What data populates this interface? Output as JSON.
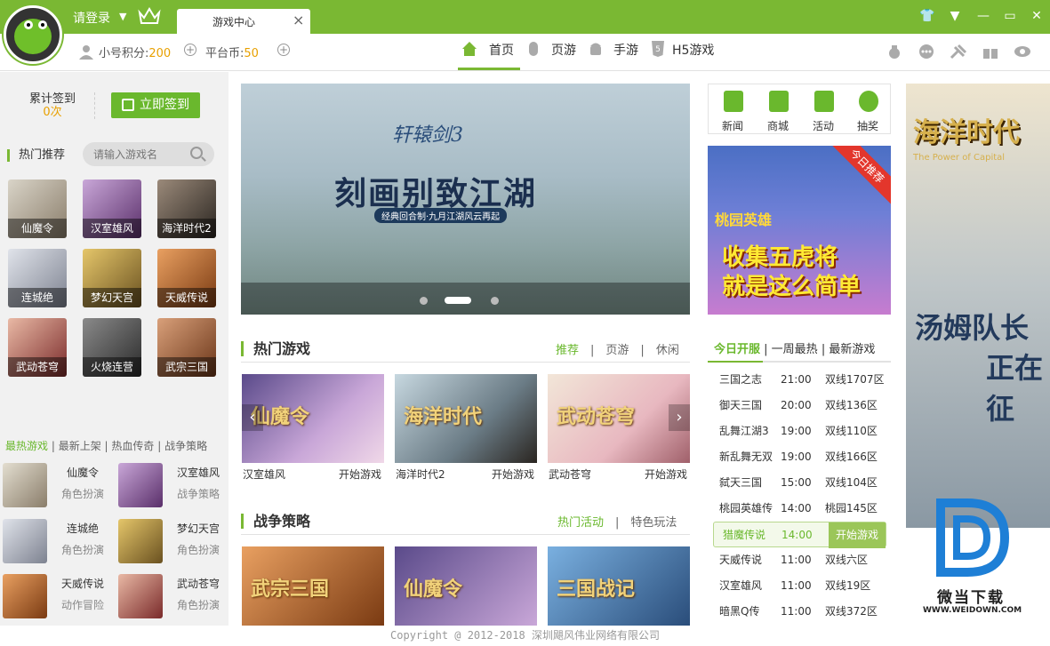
{
  "header": {
    "login": "请登录",
    "tab_title": "游戏中心",
    "tab_close": "×",
    "score_label": "小号积分:",
    "score_value": "200",
    "coin_label": "平台币:",
    "coin_value": "50",
    "nav": [
      "首页",
      "页游",
      "手游",
      "H5游戏"
    ]
  },
  "left": {
    "sign_label": "累计签到",
    "sign_count": "0次",
    "sign_button": "立即签到",
    "hot_title": "热门推荐",
    "search_placeholder": "请输入游戏名",
    "hot_games": [
      "仙魔令",
      "汉室雄风",
      "海洋时代2",
      "连城绝",
      "梦幻天宫",
      "天威传说",
      "武动苍穹",
      "火烧连营",
      "武宗三国"
    ],
    "tabs": [
      "最热游戏",
      "最新上架",
      "热血传奇",
      "战争策略"
    ],
    "list": [
      {
        "name": "仙魔令",
        "type": "角色扮演"
      },
      {
        "name": "汉室雄风",
        "type": "战争策略"
      },
      {
        "name": "连城绝",
        "type": "角色扮演"
      },
      {
        "name": "梦幻天宫",
        "type": "角色扮演"
      },
      {
        "name": "天威传说",
        "type": "动作冒险"
      },
      {
        "name": "武动苍穹",
        "type": "角色扮演"
      }
    ]
  },
  "banner": {
    "logo": "轩辕剑3",
    "title": "刻画别致江湖",
    "subtitle": "经典回合制·九月江湖风云再起"
  },
  "hot": {
    "title": "热门游戏",
    "tabs": [
      "推荐",
      "页游",
      "休闲"
    ],
    "cards": [
      {
        "art": "仙魔令",
        "name": "汉室雄风",
        "play": "开始游戏"
      },
      {
        "art": "海洋时代",
        "name": "海洋时代2",
        "play": "开始游戏"
      },
      {
        "art": "武动苍穹",
        "name": "武动苍穹",
        "play": "开始游戏"
      }
    ]
  },
  "war": {
    "title": "战争策略",
    "tabs": [
      "热门活动",
      "特色玩法"
    ],
    "cards": [
      {
        "art": "武宗三国"
      },
      {
        "art": "仙魔令"
      },
      {
        "art": "三国战记"
      }
    ]
  },
  "quick": [
    "新闻",
    "商城",
    "活动",
    "抽奖"
  ],
  "promo": {
    "badge": "今日推荐",
    "logo": "桃园英雄",
    "line1": "收集五虎将",
    "line2": "就是这么简单"
  },
  "servers": {
    "tabs": [
      "今日开服",
      "一周最热",
      "最新游戏"
    ],
    "rows": [
      {
        "name": "三国之志",
        "time": "21:00",
        "server": "双线1707区"
      },
      {
        "name": "御天三国",
        "time": "20:00",
        "server": "双线136区"
      },
      {
        "name": "乱舞江湖3",
        "time": "19:00",
        "server": "双线110区"
      },
      {
        "name": "新乱舞无双",
        "time": "19:00",
        "server": "双线166区"
      },
      {
        "name": "弑天三国",
        "time": "15:00",
        "server": "双线104区"
      },
      {
        "name": "桃园英雄传",
        "time": "14:00",
        "server": "桃园145区"
      },
      {
        "name": "猎魔传说",
        "time": "14:00",
        "server": "开始游戏"
      },
      {
        "name": "天威传说",
        "time": "11:00",
        "server": "双线六区"
      },
      {
        "name": "汉室雄风",
        "time": "11:00",
        "server": "双线19区"
      },
      {
        "name": "暗黑Q传",
        "time": "11:00",
        "server": "双线372区"
      }
    ]
  },
  "ad": {
    "title": "海洋时代",
    "subtitle": "The Power of Capital",
    "big1": "汤姆队长",
    "big2": "正在征"
  },
  "watermark": {
    "title": "微当下载",
    "url": "WWW.WEIDOWN.COM"
  },
  "footer": "Copyright @ 2012-2018 深圳飓风伟业网络有限公司",
  "colors": {
    "brand": "#7ab833",
    "accent": "#6ab82d",
    "score": "#e8a000"
  }
}
